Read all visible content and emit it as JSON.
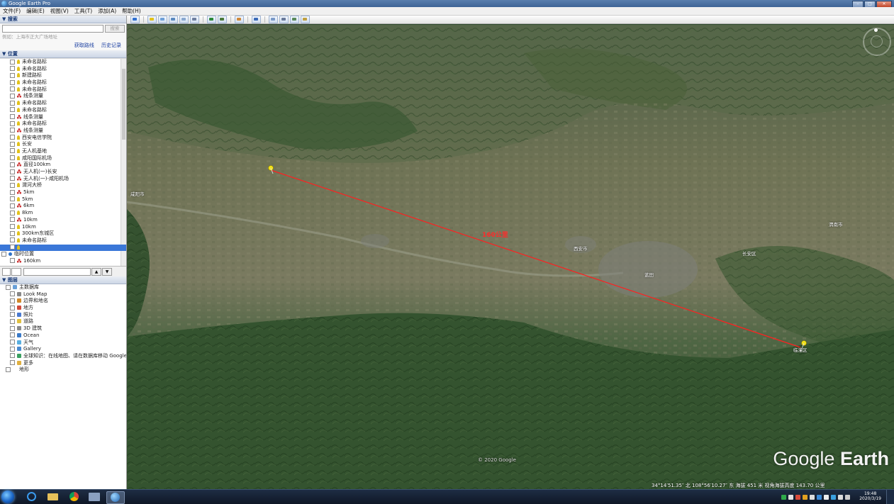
{
  "window": {
    "title": "Google Earth Pro"
  },
  "menu": [
    "文件(F)",
    "编辑(E)",
    "视图(V)",
    "工具(T)",
    "添加(A)",
    "帮助(H)"
  ],
  "search": {
    "header": "▼ 搜索",
    "button": "搜索",
    "hint": "例如：上海市正大广场地址",
    "link_directions": "获取路线",
    "link_history": "历史记录"
  },
  "places": {
    "header": "▼ 位置",
    "items": [
      {
        "label": "未命名路标",
        "type": "pin"
      },
      {
        "label": "未命名路标",
        "type": "pin"
      },
      {
        "label": "新建路标",
        "type": "pin"
      },
      {
        "label": "未命名路标",
        "type": "pin"
      },
      {
        "label": "未命名路标",
        "type": "pin"
      },
      {
        "label": "线条测量",
        "type": "path"
      },
      {
        "label": "未命名路标",
        "type": "pin"
      },
      {
        "label": "未命名路标",
        "type": "pin"
      },
      {
        "label": "线条测量",
        "type": "path"
      },
      {
        "label": "未命名路标",
        "type": "pin"
      },
      {
        "label": "线条测量",
        "type": "path"
      },
      {
        "label": "西安电信学院",
        "type": "pin"
      },
      {
        "label": "长安",
        "type": "pin"
      },
      {
        "label": "无人机基地",
        "type": "pin"
      },
      {
        "label": "咸阳国际机场",
        "type": "pin"
      },
      {
        "label": "直径100km",
        "type": "path"
      },
      {
        "label": "无人机(一)长安",
        "type": "path"
      },
      {
        "label": "无人机(一)-咸阳机场",
        "type": "path"
      },
      {
        "label": "渭河大桥",
        "type": "pin"
      },
      {
        "label": "5km",
        "type": "path"
      },
      {
        "label": "5km",
        "type": "pin"
      },
      {
        "label": "6km",
        "type": "path"
      },
      {
        "label": "8km",
        "type": "pin"
      },
      {
        "label": "10km",
        "type": "path"
      },
      {
        "label": "10km",
        "type": "pin"
      },
      {
        "label": "300km东城区",
        "type": "pin"
      },
      {
        "label": "未命名路标",
        "type": "pin"
      },
      {
        "label": "",
        "type": "selected"
      },
      {
        "label": "临时位置",
        "type": "folder"
      },
      {
        "label": "160km",
        "type": "path"
      }
    ]
  },
  "layers": {
    "header": "▼ 图层",
    "items": [
      {
        "label": "主数据库",
        "level": 0,
        "color": "#6aa0d8"
      },
      {
        "label": "Look Map",
        "level": 1,
        "color": "#888888"
      },
      {
        "label": "边界和地名",
        "level": 1,
        "color": "#d08a2a"
      },
      {
        "label": "地方",
        "level": 1,
        "color": "#d04a3a"
      },
      {
        "label": "照片",
        "level": 1,
        "color": "#4a7ad0"
      },
      {
        "label": "道路",
        "level": 1,
        "color": "#e0c040"
      },
      {
        "label": "3D 建筑",
        "level": 1,
        "color": "#8a8a8a"
      },
      {
        "label": "Ocean",
        "level": 1,
        "color": "#3a7ac8"
      },
      {
        "label": "天气",
        "level": 1,
        "color": "#5ab0e0"
      },
      {
        "label": "Gallery",
        "level": 1,
        "color": "#4a8ad0"
      },
      {
        "label": "全球知识：在线地图、请在数据库移动 Google",
        "level": 1,
        "color": "#3aa060"
      },
      {
        "label": "更多",
        "level": 1,
        "color": "#e0b040"
      },
      {
        "label": "地形",
        "level": 0,
        "color": "#ffffff"
      }
    ]
  },
  "map": {
    "measure_label": "160公里",
    "place_labels": [
      "咸阳市",
      "西安市",
      "蓝田",
      "长安区",
      "渭南市",
      "临潼区"
    ],
    "copyright": "© 2020 Google",
    "status": "34°14′51.35″ 北 108°56′10.27″ 东  海拔 451 米  视角海拔高度 143.70 公里",
    "logo_light": "Google",
    "logo_bold": "Earth"
  },
  "taskbar": {
    "time": "19:48",
    "date": "2020/3/19"
  }
}
